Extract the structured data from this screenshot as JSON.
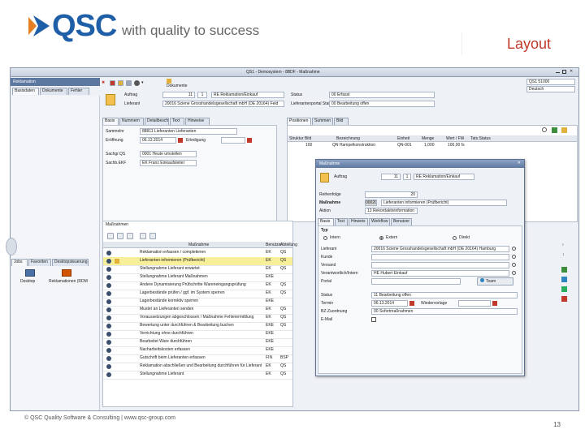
{
  "header": {
    "logo_text": "QSC",
    "tagline": "with quality to success",
    "slide_title": "Layout",
    "brand_color": "#1f5fa8",
    "accent_color": "#c0392b"
  },
  "footer": {
    "copyright": "© QSC Quality Software & Consulting | www.qsc-group.com",
    "page_number": "13"
  },
  "app": {
    "window_title": "QS1 - Demosystem - 8BDF - Maßnahme",
    "module_title": "Reklamation",
    "top_tabs": [
      "Basisdaten",
      "Dokumente",
      "Fehler"
    ],
    "toolbar_button": "Dokumente",
    "right_selects": [
      "QS1 51000",
      "Deutsch"
    ],
    "form": {
      "auftrag_label": "Auftrag",
      "auftrag_value": "11",
      "auftrag_no": "1",
      "auftrag_type": "RE Reklamation/Einkauf",
      "lieferant_label": "Lieferant",
      "lieferant_value": "20016 Sciene Grosshandelsgesellschaft mbH (DE 20164) Feld",
      "status_label": "Status",
      "status_value": "00 Erfasst",
      "lieferstatus_label": "Lieferantenportal Status",
      "lieferstatus_value": "00 Bearbeitung offen"
    },
    "left_tabs": [
      "Basis",
      "Nummern",
      "Detailbeschreibung",
      "Text",
      "Hinweise"
    ],
    "left_fields": [
      {
        "label": "Sammelnr",
        "value": "88811 Lieferanten Lieferanten"
      },
      {
        "label": "Eröffnung",
        "value": "06.13.2014",
        "extra": "Erledigung"
      },
      {
        "label": "Sachgr.QS",
        "value": "0001 Heute umstellen"
      },
      {
        "label": "Sachb.EKF",
        "value": "EK Franz Einkaufsleiter"
      }
    ],
    "right_tabs": [
      "Positionen",
      "Summen",
      "Bild"
    ],
    "positions_headers": [
      "Struktur Bild",
      "Bezeichnung",
      "Einheit",
      "Menge",
      "Wert / FW",
      "Tats.Status"
    ],
    "positions_row": [
      "100",
      "QN Hampelkonstruktion",
      "QN-001",
      "1,000",
      "100,00 fs",
      ""
    ],
    "desktop_tabs": [
      "Jobs",
      "Favoriten",
      "Desktopsteuerung"
    ],
    "desktop_icons": [
      "Desktop",
      "Reklamationen (RDM)"
    ],
    "measures_title": "Maßnahmen",
    "measures_headers": [
      "",
      "",
      "Maßnahme",
      "Benutzer",
      "Abteilung"
    ],
    "measures": [
      {
        "text": "Reklamation erfassen / completieren",
        "user": "EK",
        "dept": "QS"
      },
      {
        "text": "Lieferanten informieren (Prüfbericht)",
        "user": "EK",
        "dept": "QS"
      },
      {
        "text": "Stellungnahme Lieferant erwartet",
        "user": "EK",
        "dept": "QS"
      },
      {
        "text": "Stellungnahme Lieferant Maßnahmen",
        "user": "EKE",
        "dept": ""
      },
      {
        "text": "Andere Dynamisierung Prüfschritte Wareneingangsprüfung",
        "user": "EK",
        "dept": "QS"
      },
      {
        "text": "Lagerbestände prüfen / ggf. im System sperren",
        "user": "EK",
        "dept": "QS"
      },
      {
        "text": "Lagerbestände korrektiv sperren",
        "user": "EKE",
        "dept": ""
      },
      {
        "text": "Muster an Lieferanten senden",
        "user": "EK",
        "dept": "QS"
      },
      {
        "text": "Voraussetzungen abgeschlossen / Maßnahme Fehlerermittlung",
        "user": "EK",
        "dept": "QS"
      },
      {
        "text": "Bewertung unter durchführen & Bearbeitung buchen",
        "user": "EKE",
        "dept": "QS"
      },
      {
        "text": "Verrichtung ohne durchführen",
        "user": "EKE",
        "dept": ""
      },
      {
        "text": "Bearbeitet Ware durchführen",
        "user": "EKE",
        "dept": ""
      },
      {
        "text": "Nacharbeitskosten erfassen",
        "user": "EKE",
        "dept": ""
      },
      {
        "text": "Gutschrift beim Lieferanten erfassen",
        "user": "FIN",
        "dept": "BSP"
      },
      {
        "text": "Reklamation abschließen und Bearbeitung durchführen für Lieferant",
        "user": "EK",
        "dept": "QS"
      },
      {
        "text": "Stellungnahme Lieferant",
        "user": "EK",
        "dept": "QS"
      }
    ],
    "dialog": {
      "title": "Maßnahme",
      "auftrag_label": "Auftrag",
      "auftrag_value": "11",
      "auftrag_no": "1",
      "auftrag_type": "RE Reklamation/Einkauf",
      "reihenfolge_label": "Reihenfolge",
      "reihenfolge_value": "20",
      "massnahme_label": "Maßnahme",
      "massnahme_value": "00020",
      "massnahme_text": "Lieferanten informieren (Prüfbericht)",
      "aktion_label": "Aktion",
      "aktion_value": "13 Rekordaktivinformation",
      "tabs": [
        "Basis",
        "Text",
        "Hinweis",
        "Workflow",
        "Benutzer"
      ],
      "typ_label": "Typ",
      "typ_options": [
        "Intern",
        "Extern",
        "Direkt"
      ],
      "lieferant_label": "Lieferant",
      "lieferant_value": "20016 Sciene Grosshandelsgesellschaft mbH (DE 20164) Hamburg",
      "kunde_label": "Kunde",
      "versand_label": "Versand",
      "verantwortlich_label": "Verantwortlich/Intern",
      "verantwortlich_value": "HE Hubert Einkauf",
      "portal_label": "Portal",
      "team_button": "Team",
      "status_label": "Status",
      "status_value": "11 Bearbeitung offen",
      "termin_label": "Termin",
      "termin_value": "06.13.2014",
      "wiedervorlage_label": "Wiedervorlage",
      "bezug_label": "BZ-Zuordnung",
      "bezug_value": "00 Sofortmaßnahmen",
      "email_label": "E-Mail"
    }
  }
}
